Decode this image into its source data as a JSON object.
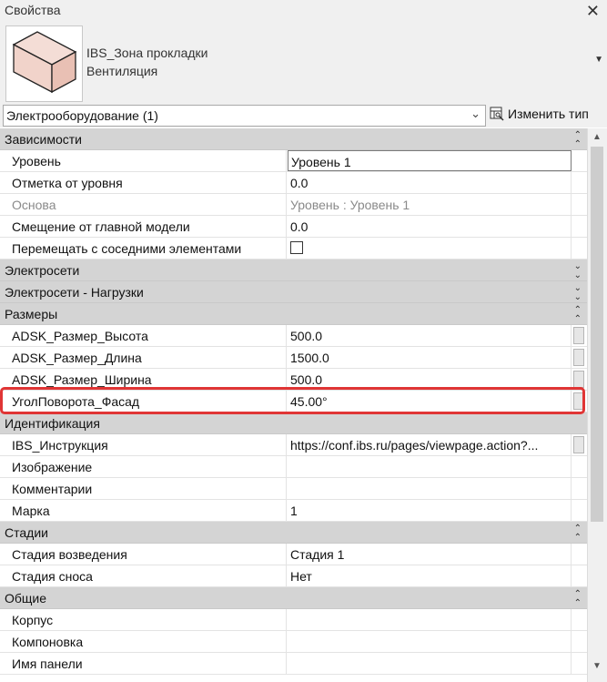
{
  "window": {
    "title": "Свойства",
    "close_glyph": "✕"
  },
  "type_selector": {
    "name_line1": "IBS_Зона прокладки",
    "name_line2": "Вентиляция",
    "arrow_glyph": "▼"
  },
  "filter": {
    "selected": "Электрооборудование (1)",
    "edit_type_label": "Изменить тип"
  },
  "groups": {
    "constraints": "Зависимости",
    "electrical": "Электросети",
    "electrical_loads": "Электросети - Нагрузки",
    "dimensions": "Размеры",
    "identity": "Идентификация",
    "phasing": "Стадии",
    "general": "Общие"
  },
  "glyphs": {
    "collapse": "⌃",
    "expand": "⌄"
  },
  "props": {
    "level": {
      "name": "Уровень",
      "value": "Уровень 1"
    },
    "offset": {
      "name": "Отметка от уровня",
      "value": "0.0"
    },
    "host": {
      "name": "Основа",
      "value": "Уровень : Уровень 1"
    },
    "host_offset": {
      "name": "Смещение от главной модели",
      "value": "0.0"
    },
    "move_with": {
      "name": "Перемещать с соседними элементами",
      "checked": false
    },
    "height": {
      "name": "ADSK_Размер_Высота",
      "value": "500.0"
    },
    "length": {
      "name": "ADSK_Размер_Длина",
      "value": "1500.0"
    },
    "width": {
      "name": "ADSK_Размер_Ширина",
      "value": "500.0"
    },
    "angle": {
      "name": "УголПоворота_Фасад",
      "value": "45.00°"
    },
    "instruction": {
      "name": "IBS_Инструкция",
      "value": "https://conf.ibs.ru/pages/viewpage.action?..."
    },
    "image": {
      "name": "Изображение",
      "value": ""
    },
    "comments": {
      "name": "Комментарии",
      "value": ""
    },
    "mark": {
      "name": "Марка",
      "value": "1"
    },
    "phase_created": {
      "name": "Стадия возведения",
      "value": "Стадия 1"
    },
    "phase_demolished": {
      "name": "Стадия сноса",
      "value": "Нет"
    },
    "case": {
      "name": "Корпус",
      "value": ""
    },
    "layout": {
      "name": "Компоновка",
      "value": ""
    },
    "panel_name": {
      "name": "Имя панели",
      "value": ""
    }
  },
  "colors": {
    "highlight": "#e03535",
    "group_bg": "#d4d4d4"
  }
}
